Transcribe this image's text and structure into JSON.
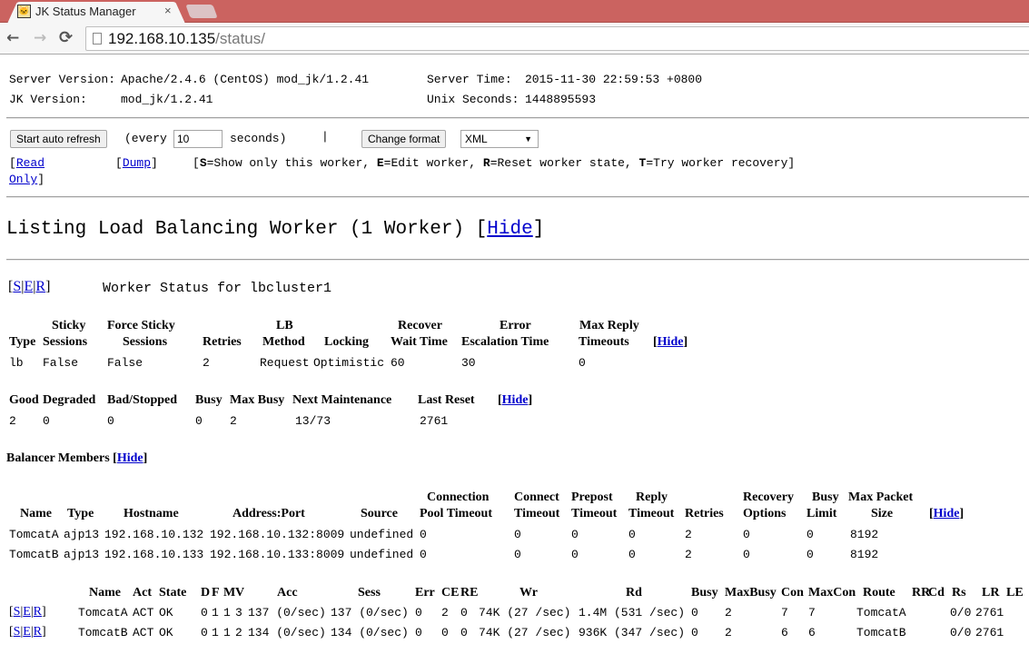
{
  "browser": {
    "tab_title": "JK Status Manager",
    "tab_close": "×",
    "url_host": "192.168.10.135",
    "url_path": "/status/",
    "icons": {
      "back": "←",
      "forward": "→",
      "reload": "⟳",
      "favicon": "tomcat-icon",
      "page": "page-icon"
    }
  },
  "server": {
    "server_version_label": "Server Version:",
    "server_version": "Apache/2.4.6 (CentOS) mod_jk/1.2.41",
    "jk_version_label": "JK Version:",
    "jk_version": "mod_jk/1.2.41",
    "server_time_label": "Server Time:",
    "server_time": "2015-11-30 22:59:53 +0800",
    "unix_seconds_label": "Unix Seconds:",
    "unix_seconds": "1448895593"
  },
  "controls": {
    "auto_refresh_button": "Start auto refresh",
    "every_prefix": "(every",
    "refresh_seconds": "10",
    "seconds_suffix": "seconds)",
    "separator": "|",
    "change_format_button": "Change format",
    "format_selected": "XML",
    "read_only_link_a": "Read",
    "read_only_link_b": "Only",
    "dump_link": "Dump",
    "legend": {
      "s_key": "S",
      "s_text": "=Show only this worker, ",
      "e_key": "E",
      "e_text": "=Edit worker, ",
      "r_key": "R",
      "r_text": "=Reset worker state, ",
      "t_key": "T",
      "t_text": "=Try worker recovery]"
    }
  },
  "listing": {
    "title": "Listing Load Balancing Worker (1 Worker) [",
    "hide": "Hide",
    "close_bracket": "]"
  },
  "worker": {
    "links": [
      "S",
      "E",
      "R"
    ],
    "title": "Worker Status for lbcluster1",
    "config_table": {
      "headers_top": [
        "",
        "Sticky",
        "Force Sticky",
        "",
        "LB",
        "",
        "Recover",
        "Error",
        "Max Reply"
      ],
      "headers": [
        "Type",
        "Sessions",
        "Sessions",
        "Retries",
        "Method",
        "Locking",
        "Wait Time",
        "Escalation Time",
        "Timeouts"
      ],
      "row": [
        "lb",
        "False",
        "False",
        "2",
        "Request",
        "Optimistic",
        "60",
        "30",
        "0"
      ],
      "hide": "Hide"
    },
    "status_table": {
      "headers": [
        "Good",
        "Degraded",
        "Bad/Stopped",
        "Busy",
        "Max Busy",
        "Next Maintenance",
        "Last Reset"
      ],
      "row": [
        "2",
        "0",
        "0",
        "0",
        "2",
        "13/73",
        "2761"
      ],
      "hide": "Hide"
    }
  },
  "members": {
    "title": "Balancer Members [",
    "hide": "Hide",
    "config_table": {
      "headers_top": [
        "",
        "",
        "",
        "",
        "",
        "Connection",
        "Connect",
        "Prepost",
        "Reply",
        "",
        "Recovery",
        "Busy",
        "Max Packet"
      ],
      "headers": [
        "Name",
        "Type",
        "Hostname",
        "Address:Port",
        "Source",
        "Pool Timeout",
        "Timeout",
        "Timeout",
        "Timeout",
        "Retries",
        "Options",
        "Limit",
        "Size"
      ],
      "rows": [
        [
          "TomcatA",
          "ajp13",
          "192.168.10.132",
          "192.168.10.132:8009",
          "undefined",
          "0",
          "0",
          "0",
          "0",
          "2",
          "0",
          "0",
          "8192"
        ],
        [
          "TomcatB",
          "ajp13",
          "192.168.10.133",
          "192.168.10.133:8009",
          "undefined",
          "0",
          "0",
          "0",
          "0",
          "2",
          "0",
          "0",
          "8192"
        ]
      ],
      "hide": "Hide"
    },
    "status_table": {
      "headers": [
        "Name",
        "Act",
        "State",
        "D",
        "F",
        "M",
        "V",
        "Acc",
        "Sess",
        "Err",
        "CE",
        "RE",
        "Wr",
        "Rd",
        "Busy",
        "MaxBusy",
        "Con",
        "MaxCon",
        "Route",
        "RR",
        "Cd",
        "Rs",
        "LR",
        "LE"
      ],
      "rows": [
        {
          "links": [
            "S",
            "E",
            "R"
          ],
          "cells": [
            "TomcatA",
            "ACT",
            "OK",
            "0",
            "1",
            "1",
            "3",
            "137 (0/sec)",
            "137 (0/sec)",
            "0",
            "2",
            "0",
            "74K (27 /sec)",
            "1.4M (531 /sec)",
            "0",
            "2",
            "7",
            "7",
            "TomcatA",
            "",
            "",
            "0/0",
            "2761",
            ""
          ]
        },
        {
          "links": [
            "S",
            "E",
            "R"
          ],
          "cells": [
            "TomcatB",
            "ACT",
            "OK",
            "0",
            "1",
            "1",
            "2",
            "134 (0/sec)",
            "134 (0/sec)",
            "0",
            "0",
            "0",
            "74K (27 /sec)",
            "936K (347 /sec)",
            "0",
            "2",
            "6",
            "6",
            "TomcatB",
            "",
            "",
            "0/0",
            "2761",
            ""
          ]
        }
      ]
    }
  }
}
